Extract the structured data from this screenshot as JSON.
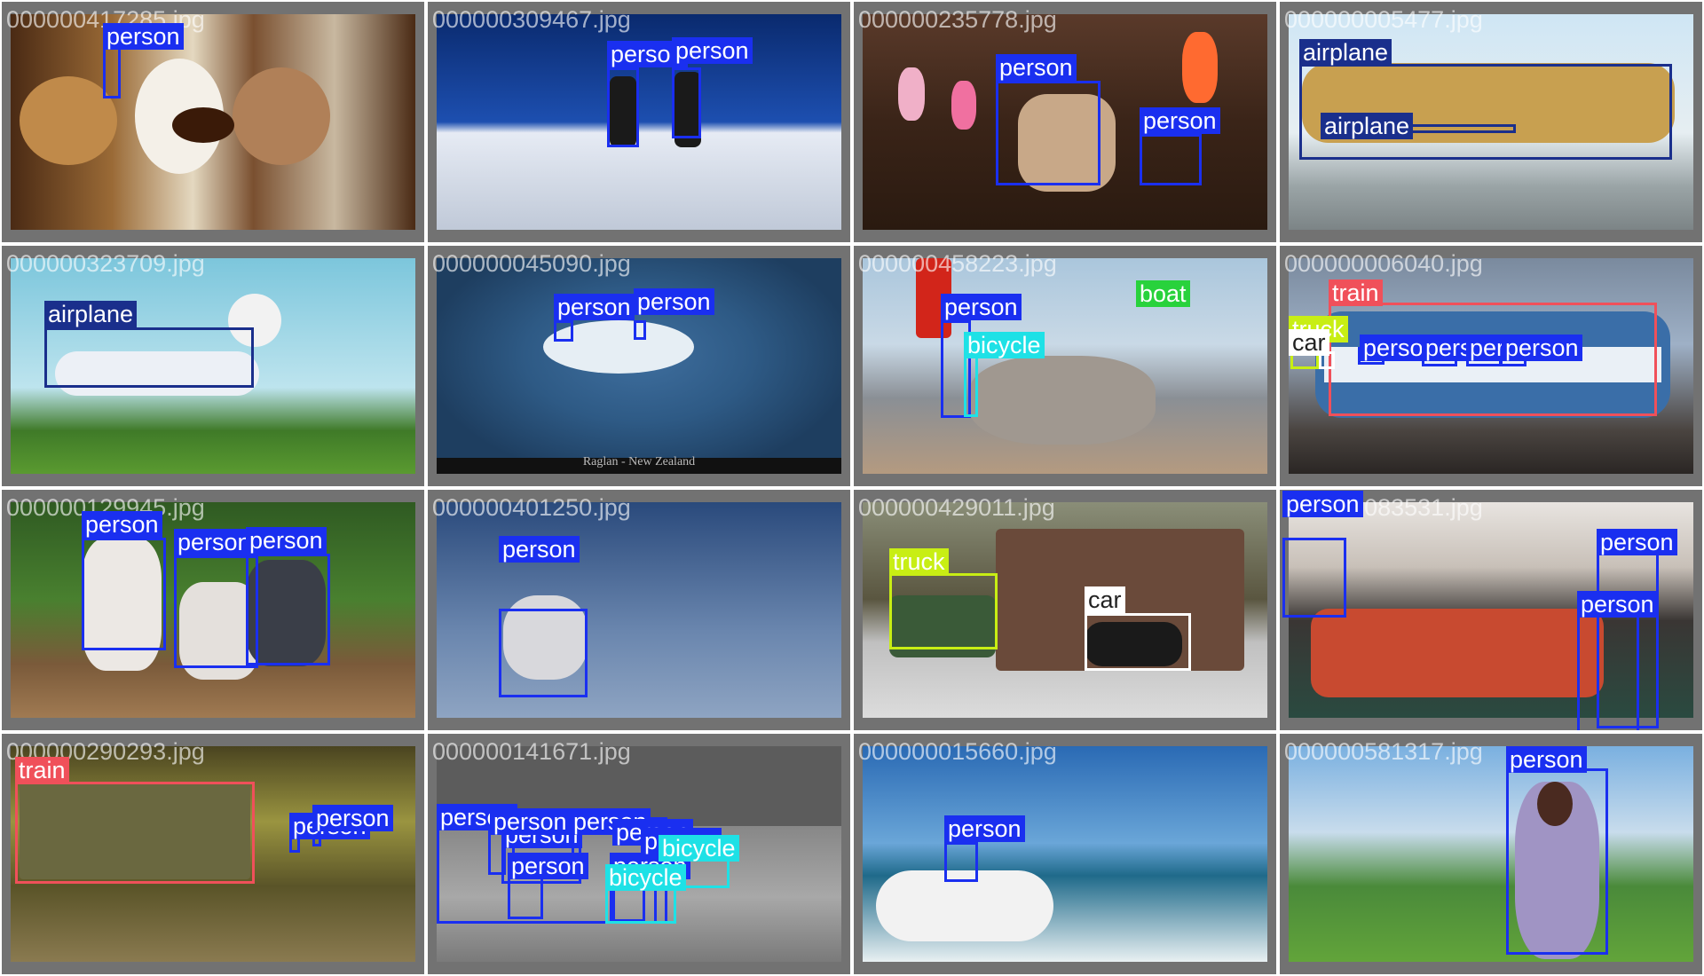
{
  "grid": {
    "background_color": "#727272",
    "class_colors": {
      "person": "#1a2ff0",
      "airplane": "#1a2f8c",
      "train": "#f0505a",
      "truck": "#c8ee14",
      "car": "#ffffff",
      "boat": "#28d23c",
      "bicycle": "#1ee1e6"
    },
    "images": [
      {
        "filename": "000000417285.jpg",
        "scene": "pastries and coffee on plates",
        "detections": [
          {
            "label": "person"
          }
        ]
      },
      {
        "filename": "000000309467.jpg",
        "scene": "two skiers on a snowy slope",
        "detections": [
          {
            "label": "person"
          },
          {
            "label": "person"
          }
        ]
      },
      {
        "filename": "000000235778.jpg",
        "scene": "man hanging paper kites",
        "detections": [
          {
            "label": "person"
          },
          {
            "label": "person"
          }
        ]
      },
      {
        "filename": "000000005477.jpg",
        "scene": "gold LOT airliner on runway",
        "detections": [
          {
            "label": "airplane"
          },
          {
            "label": "airplane"
          }
        ]
      },
      {
        "filename": "000000323709.jpg",
        "scene": "cargo jumbo jet taking off",
        "detections": [
          {
            "label": "airplane"
          }
        ]
      },
      {
        "filename": "000000045090.jpg",
        "scene": "surfers on a wave",
        "caption": "Raglan - New Zealand",
        "detections": [
          {
            "label": "person"
          },
          {
            "label": "person"
          }
        ]
      },
      {
        "filename": "000000458223.jpg",
        "scene": "red lighthouse and rocky pier",
        "detections": [
          {
            "label": "person"
          },
          {
            "label": "bicycle"
          },
          {
            "label": "boat"
          }
        ]
      },
      {
        "filename": "000000006040.jpg",
        "scene": "blue and white tram",
        "detections": [
          {
            "label": "train"
          },
          {
            "label": "truck"
          },
          {
            "label": "car"
          },
          {
            "label": "person"
          },
          {
            "label": "person"
          },
          {
            "label": "person"
          },
          {
            "label": "person"
          }
        ]
      },
      {
        "filename": "000000129945.jpg",
        "scene": "baseball batter, catcher and umpire",
        "detections": [
          {
            "label": "person"
          },
          {
            "label": "person"
          },
          {
            "label": "person"
          }
        ]
      },
      {
        "filename": "000000401250.jpg",
        "scene": "skier mid-air against the sky",
        "detections": [
          {
            "label": "person"
          }
        ]
      },
      {
        "filename": "000000429011.jpg",
        "scene": "model town with truck and car",
        "detections": [
          {
            "label": "truck"
          },
          {
            "label": "car"
          }
        ]
      },
      {
        "filename": "000000083531.jpg",
        "scene": "sausages on a grill",
        "detections": [
          {
            "label": "person"
          },
          {
            "label": "person"
          },
          {
            "label": "person"
          }
        ]
      },
      {
        "filename": "000000290293.jpg",
        "scene": "train in a subway station",
        "detections": [
          {
            "label": "train"
          },
          {
            "label": "person"
          },
          {
            "label": "person"
          }
        ]
      },
      {
        "filename": "000000141671.jpg",
        "scene": "black and white street scene",
        "detections": [
          {
            "label": "person"
          },
          {
            "label": "person"
          },
          {
            "label": "person"
          },
          {
            "label": "person"
          },
          {
            "label": "person"
          },
          {
            "label": "person"
          },
          {
            "label": "person"
          },
          {
            "label": "person"
          },
          {
            "label": "bicycle"
          },
          {
            "label": "bicycle"
          }
        ]
      },
      {
        "filename": "000000015660.jpg",
        "scene": "windsurfer on the sea",
        "detections": [
          {
            "label": "person"
          }
        ]
      },
      {
        "filename": "000000581317.jpg",
        "scene": "woman with phone on a green hill",
        "detections": [
          {
            "label": "person"
          }
        ]
      }
    ]
  }
}
